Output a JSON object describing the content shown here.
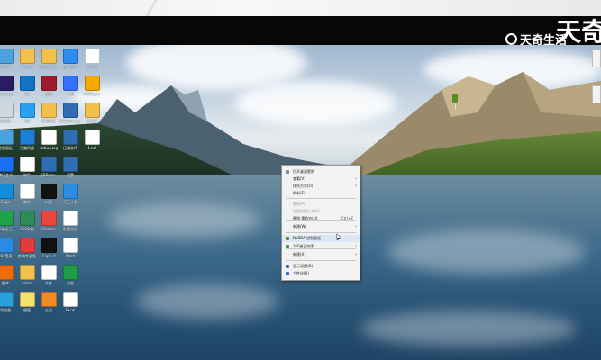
{
  "watermark": {
    "text": "天奇生活",
    "big_char": "天奇"
  },
  "desktop_icons": [
    {
      "label": "此电脑",
      "color": "#4aa3df"
    },
    {
      "label": "Winter",
      "color": "#f3c14b"
    },
    {
      "label": "新建文件夹",
      "color": "#f3c14b"
    },
    {
      "label": "百度网盘",
      "color": "#2d8cf0"
    },
    {
      "label": "工作表",
      "color": "#ffffff"
    },
    {
      "label": "Premiere",
      "color": "#2b1b63"
    },
    {
      "label": "PS",
      "color": "#1572c6"
    },
    {
      "label": "截图",
      "color": "#9b1c2c"
    },
    {
      "label": "飞书",
      "color": "#3370ff"
    },
    {
      "label": "PotPlayer",
      "color": "#f2a900"
    },
    {
      "label": "回收站",
      "color": "#cfd8dc"
    },
    {
      "label": "QQ",
      "color": "#2aa0f0"
    },
    {
      "label": "腾讯QQ",
      "color": "#f3c14b"
    },
    {
      "label": "JDDown.zip",
      "color": "#2f6db5"
    },
    {
      "label": "文件夹",
      "color": "#f3c14b"
    },
    {
      "label": "控制面板",
      "color": "#4aa3df"
    },
    {
      "label": "百度网盘",
      "color": "#1e7fd8"
    },
    {
      "label": "debug.log",
      "color": "#ffffff"
    },
    {
      "label": "压缩文件",
      "color": "#2f6db5"
    },
    {
      "label": "1.txt",
      "color": "#ffffff"
    },
    {
      "label": "腾讯会议",
      "color": "#1d6ff2"
    },
    {
      "label": "软件",
      "color": "#ffffff"
    },
    {
      "label": "JDDown",
      "color": "#2f6db5"
    },
    {
      "label": "设置",
      "color": "#2f6db5"
    },
    {
      "label": "Edge",
      "color": "#138dd8"
    },
    {
      "label": "剪映",
      "color": "#ffffff"
    },
    {
      "label": "抖音",
      "color": "#111111"
    },
    {
      "label": "天天计划",
      "color": "#2a8de0"
    },
    {
      "label": "360安全卫士",
      "color": "#1fa34a"
    },
    {
      "label": "360文档",
      "color": "#2e8b57"
    },
    {
      "label": "Chrome",
      "color": "#e8463f"
    },
    {
      "label": "新建文档",
      "color": "#ffffff"
    },
    {
      "label": "360管家",
      "color": "#2b8ae6"
    },
    {
      "label": "剪映专业版",
      "color": "#e23b3b"
    },
    {
      "label": "CapCut",
      "color": "#111111"
    },
    {
      "label": "Word",
      "color": "#ffffff"
    },
    {
      "label": "图库",
      "color": "#f06d06"
    },
    {
      "label": "video",
      "color": "#f3c14b"
    },
    {
      "label": "文件",
      "color": "#ffffff"
    },
    {
      "label": "文档",
      "color": "#1e9e45"
    },
    {
      "label": "浏览器",
      "color": "#2a9fd8"
    },
    {
      "label": "便签",
      "color": "#f6e26b"
    },
    {
      "label": "工具",
      "color": "#f08a24"
    },
    {
      "label": "Excel",
      "color": "#ffffff"
    }
  ],
  "context_menu": {
    "items": [
      {
        "label": "打开桌面壁纸",
        "icon_color": "#6b8fc2",
        "disabled": false,
        "submenu": false,
        "shortcut": ""
      },
      {
        "label": "查看(V)",
        "icon_color": "",
        "disabled": false,
        "submenu": true,
        "shortcut": ""
      },
      {
        "label": "排序方式(O)",
        "icon_color": "",
        "disabled": false,
        "submenu": true,
        "shortcut": ""
      },
      {
        "label": "刷新(E)",
        "icon_color": "",
        "disabled": false,
        "submenu": false,
        "shortcut": ""
      },
      {
        "label": "粘贴(P)",
        "icon_color": "",
        "disabled": true,
        "submenu": false,
        "shortcut": ""
      },
      {
        "label": "粘贴快捷方式(S)",
        "icon_color": "",
        "disabled": true,
        "submenu": false,
        "shortcut": ""
      },
      {
        "label": "撤销 重命名(U)",
        "icon_color": "",
        "disabled": false,
        "submenu": false,
        "shortcut": "Ctrl+Z"
      },
      {
        "label": "新建(W)",
        "icon_color": "",
        "disabled": false,
        "submenu": true,
        "shortcut": ""
      },
      {
        "label": "NVIDIA 控制面板",
        "icon_color": "#5a8c1e",
        "disabled": false,
        "submenu": false,
        "shortcut": ""
      },
      {
        "label": "360桌面助手",
        "icon_color": "#2e9e4a",
        "disabled": false,
        "submenu": true,
        "shortcut": ""
      },
      {
        "label": "新建(X)",
        "icon_color": "",
        "disabled": false,
        "submenu": true,
        "shortcut": ""
      },
      {
        "label": "显示设置(D)",
        "icon_color": "#2a6fd8",
        "disabled": false,
        "submenu": false,
        "shortcut": ""
      },
      {
        "label": "个性化(R)",
        "icon_color": "#2a6fd8",
        "disabled": false,
        "submenu": false,
        "shortcut": ""
      }
    ]
  }
}
